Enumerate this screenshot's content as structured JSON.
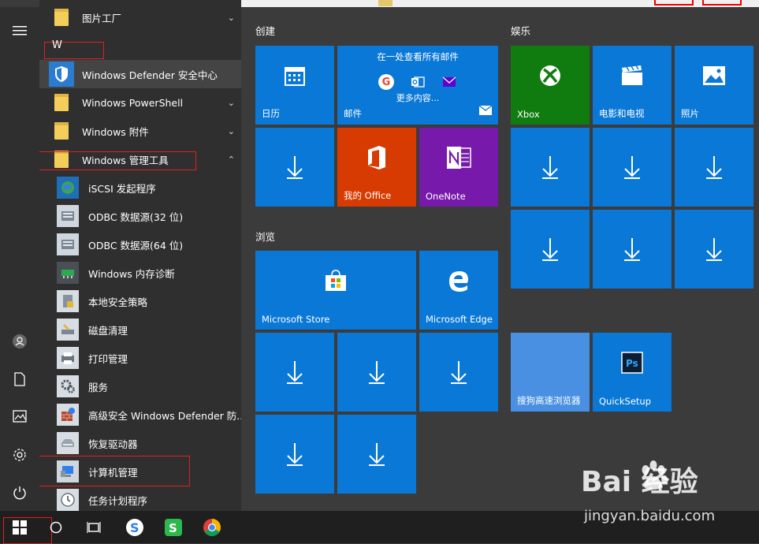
{
  "start_menu": {
    "app_list": {
      "letter_header": "W",
      "items": [
        {
          "label": "图片工厂",
          "kind": "folder"
        },
        {
          "label": "Windows Defender 安全中心",
          "kind": "app"
        },
        {
          "label": "Windows PowerShell",
          "kind": "folder"
        },
        {
          "label": "Windows 附件",
          "kind": "folder"
        },
        {
          "label": "Windows 管理工具",
          "kind": "folder-open"
        },
        {
          "label": "iSCSI 发起程序",
          "kind": "sub"
        },
        {
          "label": "ODBC 数据源(32 位)",
          "kind": "sub"
        },
        {
          "label": "ODBC 数据源(64 位)",
          "kind": "sub"
        },
        {
          "label": "Windows 内存诊断",
          "kind": "sub"
        },
        {
          "label": "本地安全策略",
          "kind": "sub"
        },
        {
          "label": "磁盘清理",
          "kind": "sub"
        },
        {
          "label": "打印管理",
          "kind": "sub"
        },
        {
          "label": "服务",
          "kind": "sub"
        },
        {
          "label": "高级安全 Windows Defender 防...",
          "kind": "sub"
        },
        {
          "label": "恢复驱动器",
          "kind": "sub"
        },
        {
          "label": "计算机管理",
          "kind": "sub"
        },
        {
          "label": "任务计划程序",
          "kind": "sub"
        }
      ]
    },
    "groups": {
      "create": "创建",
      "entertainment": "娱乐",
      "browse": "浏览"
    },
    "tiles": {
      "calendar": "日历",
      "mail": "邮件",
      "mail_banner": "在一处查看所有邮件",
      "mail_more": "更多内容...",
      "office": "我的 Office",
      "onenote": "OneNote",
      "xbox": "Xbox",
      "movies": "电影和电视",
      "photos": "照片",
      "store": "Microsoft Store",
      "edge": "Microsoft Edge",
      "sogou": "搜狗高速浏览器",
      "quicksetup": "QuickSetup"
    }
  },
  "watermark": {
    "main": "Bai 经验",
    "sub": "jingyan.baidu.com"
  },
  "colors": {
    "tile_blue": "#0a78d7",
    "xbox_green": "#107c10",
    "office_orange": "#d83b01",
    "onenote_purple": "#7719aa",
    "sogou_light": "#4a90e2",
    "highlight_red": "#e02020"
  }
}
